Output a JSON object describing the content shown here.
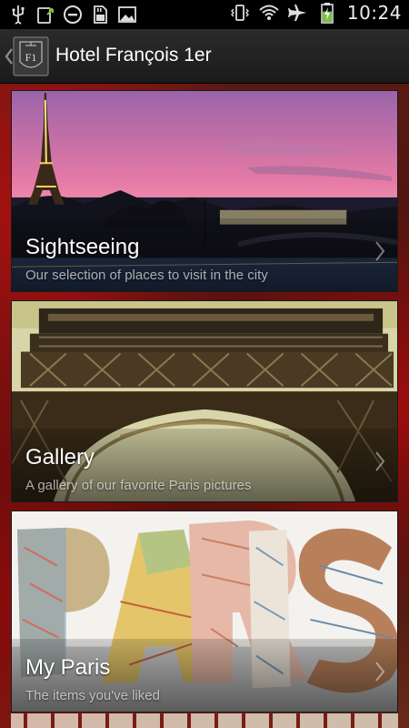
{
  "status_bar": {
    "time": "10:24",
    "icons_left": [
      "usb-icon",
      "download-icon",
      "do-not-disturb-icon",
      "sd-card-icon",
      "image-icon"
    ],
    "icons_right": [
      "vibrate-icon",
      "wifi-icon",
      "airplane-icon",
      "battery-charging-icon"
    ],
    "battery_level": 0.6
  },
  "action_bar": {
    "title": "Hotel François 1er",
    "logo_icon": "hotel-crest-icon",
    "back_icon": "back-chevron-icon"
  },
  "menu": {
    "items": [
      {
        "title": "Sightseeing",
        "subtitle": "Our selection of places to visit in the city",
        "image": "eiffel-tower-sunset-image"
      },
      {
        "title": "Gallery",
        "subtitle": "A gallery of our favorite Paris pictures",
        "image": "eiffel-tower-closeup-image"
      },
      {
        "title": "My Paris",
        "subtitle": "The items you've liked",
        "image": "paris-letters-image"
      }
    ]
  },
  "colors": {
    "action_bar": "#222222",
    "background_red": "#a00d0d",
    "text_primary": "#ffffff"
  }
}
